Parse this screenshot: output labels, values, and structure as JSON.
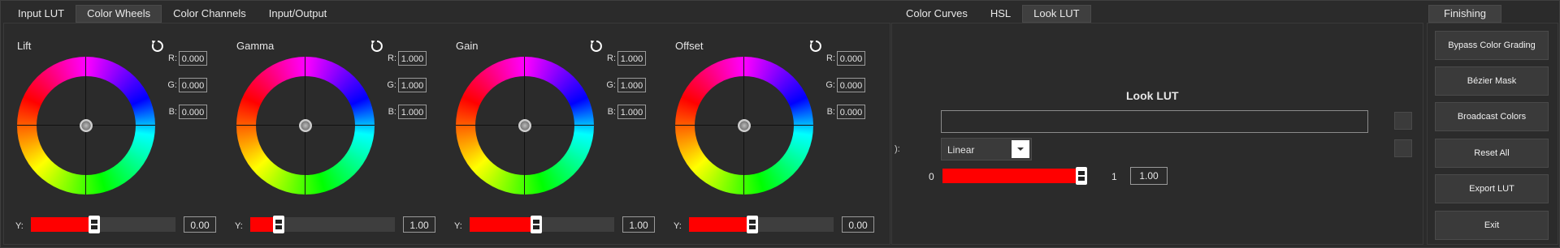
{
  "left_tabs": [
    "Input LUT",
    "Color Wheels",
    "Color Channels",
    "Input/Output"
  ],
  "left_active_tab": 1,
  "mid_tabs": [
    "Color Curves",
    "HSL",
    "Look LUT"
  ],
  "mid_active_tab": 2,
  "right_tabs": [
    "Finishing"
  ],
  "wheels": [
    {
      "title": "Lift",
      "r": "0.000",
      "g": "0.000",
      "b": "0.000",
      "y_label": "Y:",
      "y_value": "0.00",
      "y_level": 0.41
    },
    {
      "title": "Gamma",
      "r": "1.000",
      "g": "1.000",
      "b": "1.000",
      "y_label": "Y:",
      "y_value": "1.00",
      "y_level": 0.17
    },
    {
      "title": "Gain",
      "r": "1.000",
      "g": "1.000",
      "b": "1.000",
      "y_label": "Y:",
      "y_value": "1.00",
      "y_level": 0.43
    },
    {
      "title": "Offset",
      "r": "0.000",
      "g": "0.000",
      "b": "0.000",
      "y_label": "Y:",
      "y_value": "0.00",
      "y_level": 0.41
    }
  ],
  "rgb_labels": {
    "r": "R:",
    "g": "G:",
    "b": "B:"
  },
  "look_lut": {
    "title": "Look LUT",
    "file_value": "",
    "interp_label": "):",
    "interp_value": "Linear",
    "min_label": "0",
    "max_label": "1",
    "blend_value": "1.00",
    "blend_level": 1.0
  },
  "finishing_buttons": [
    "Bypass Color Grading",
    "Bézier Mask",
    "Broadcast Colors",
    "Reset All",
    "Export LUT",
    "Exit"
  ],
  "colors": {
    "background": "#2b2b2b",
    "slider_fill": "#ff0000",
    "tab_active": "#3f3f3f"
  }
}
